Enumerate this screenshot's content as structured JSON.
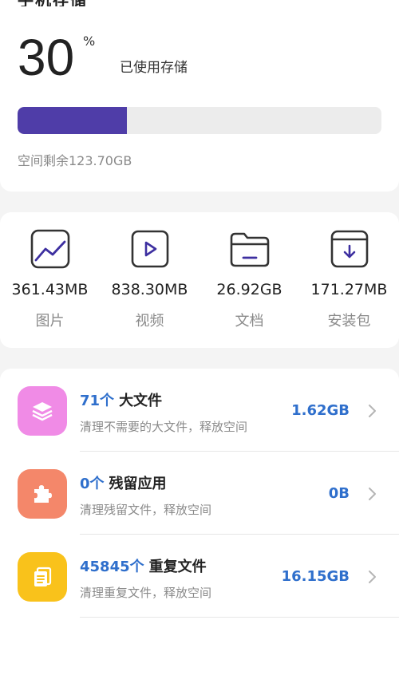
{
  "header": {
    "cut_title": "手机存储"
  },
  "usage": {
    "percent": "30",
    "percent_sign": "%",
    "label": "已使用存储",
    "fill_fraction": 0.3,
    "fill_color": "#4f3da8",
    "free_text": "空间剩余123.70GB"
  },
  "categories": [
    {
      "size": "361.43MB",
      "name": "图片",
      "icon": "image-icon"
    },
    {
      "size": "838.30MB",
      "name": "视频",
      "icon": "video-icon"
    },
    {
      "size": "26.92GB",
      "name": "文档",
      "icon": "folder-icon"
    },
    {
      "size": "171.27MB",
      "name": "安装包",
      "icon": "package-icon"
    }
  ],
  "cleanup": [
    {
      "count": "71个",
      "title": "大文件",
      "subtitle": "清理不需要的大文件，释放空间",
      "size": "1.62GB",
      "icon": "layers-icon",
      "color": "#f08be6"
    },
    {
      "count": "0个",
      "title": "残留应用",
      "subtitle": "清理残留文件，释放空间",
      "size": "0B",
      "icon": "puzzle-icon",
      "color": "#f4876a"
    },
    {
      "count": "45845个",
      "title": "重复文件",
      "subtitle": "清理重复文件，释放空间",
      "size": "16.15GB",
      "icon": "duplicate-icon",
      "color": "#f9c21b"
    }
  ],
  "colors": {
    "accent_blue": "#2f6fcc"
  }
}
